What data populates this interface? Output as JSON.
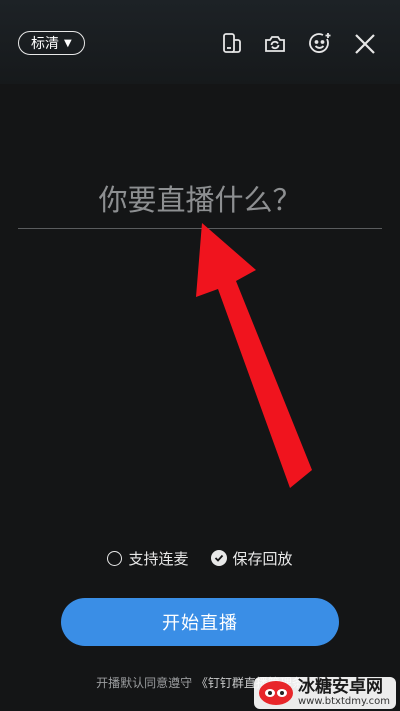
{
  "header": {
    "quality_label": "标清",
    "icons": [
      "phone-screen-icon",
      "flip-camera-icon",
      "beauty-face-icon",
      "close-icon"
    ]
  },
  "title_input": {
    "placeholder": "你要直播什么？",
    "value": ""
  },
  "options": {
    "co_host": {
      "label": "支持连麦",
      "checked": false
    },
    "save_replay": {
      "label": "保存回放",
      "checked": true
    }
  },
  "start_button": {
    "label": "开始直播"
  },
  "agreement": {
    "prefix": "开播默认同意遵守",
    "link": "《钉钉群直播管理条"
  },
  "watermark": {
    "title": "冰糖安卓网",
    "url": "www.btxtdmy.com"
  },
  "colors": {
    "background": "#141516",
    "accent": "#3a8ee6",
    "annotation_arrow": "#f0141e"
  }
}
